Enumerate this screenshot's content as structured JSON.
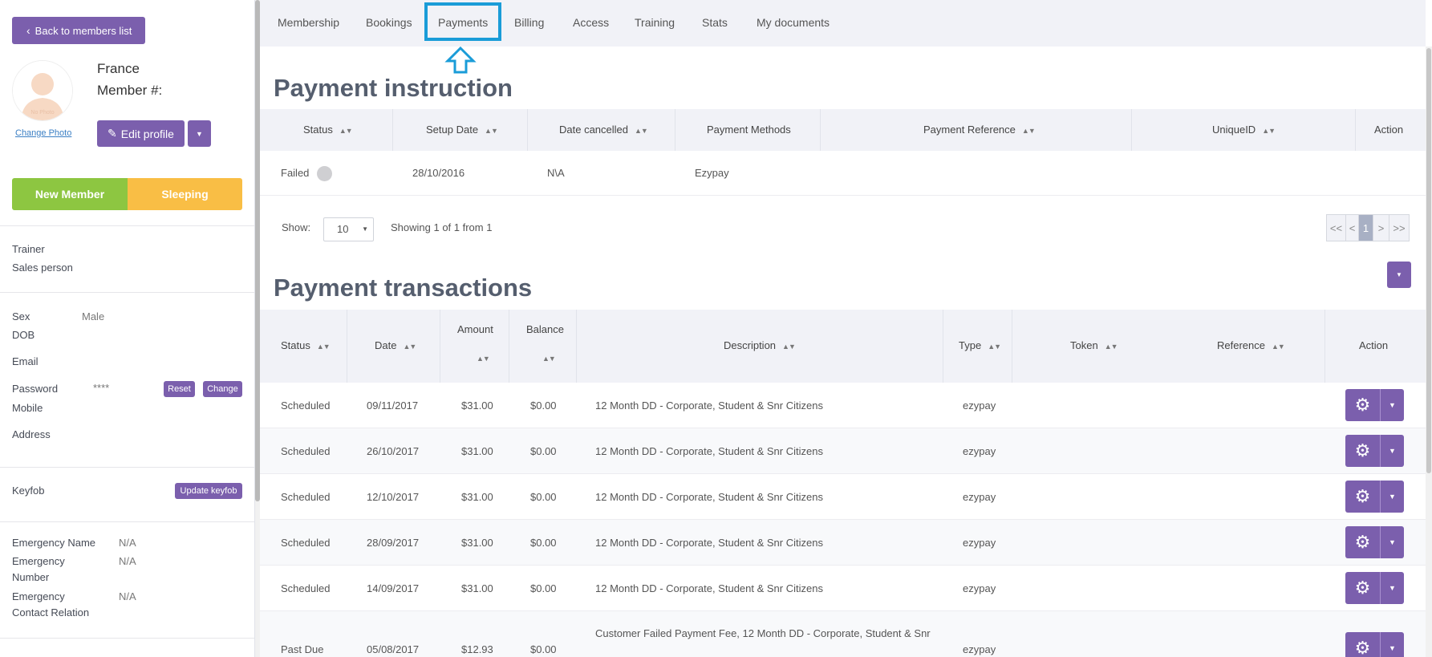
{
  "sidebar": {
    "back_label": "Back to members list",
    "avatar_text": "No Photo",
    "change_photo": "Change Photo",
    "member_name": "France",
    "member_num_label": "Member #:",
    "edit_profile": "Edit profile",
    "status_new": "New Member",
    "status_sleeping": "Sleeping",
    "trainer_label": "Trainer",
    "sales_label": "Sales person",
    "sex_label": "Sex",
    "sex_value": "Male",
    "dob_label": "DOB",
    "email_label": "Email",
    "password_label": "Password",
    "password_value": "****",
    "reset_label": "Reset",
    "change_label": "Change",
    "mobile_label": "Mobile",
    "address_label": "Address",
    "keyfob_label": "Keyfob",
    "update_keyfob": "Update keyfob",
    "emergency_name_label": "Emergency Name",
    "emergency_name_value": "N/A",
    "emergency_number_label1": "Emergency",
    "emergency_number_label2": "Number",
    "emergency_number_value": "N/A",
    "emergency_relation_label1": "Emergency",
    "emergency_relation_label2": "Contact Relation",
    "emergency_relation_value": "N/A"
  },
  "tabs": [
    "Membership",
    "Bookings",
    "Payments",
    "Billing",
    "Access",
    "Training",
    "Stats",
    "My documents"
  ],
  "active_tab": "Payments",
  "instruction": {
    "title": "Payment instruction",
    "headers": [
      "Status",
      "Setup Date",
      "Date cancelled",
      "Payment Methods",
      "Payment Reference",
      "UniqueID",
      "Action"
    ],
    "row": {
      "status": "Failed",
      "setup_date": "28/10/2016",
      "date_cancelled": "N\\A",
      "method": "Ezypay"
    },
    "show_label": "Show:",
    "page_size": "10",
    "showing": "Showing 1 of 1 from 1",
    "pager": [
      "<<",
      "<",
      "1",
      ">",
      ">>"
    ]
  },
  "transactions": {
    "title": "Payment transactions",
    "headers": {
      "status": "Status",
      "date": "Date",
      "amount": "Amount",
      "balance": "Balance",
      "description": "Description",
      "type": "Type",
      "token": "Token",
      "reference": "Reference",
      "action": "Action"
    },
    "rows": [
      {
        "status": "Scheduled",
        "date": "09/11/2017",
        "amount": "$31.00",
        "balance": "$0.00",
        "description": "12 Month DD - Corporate, Student & Snr Citizens",
        "type": "ezypay"
      },
      {
        "status": "Scheduled",
        "date": "26/10/2017",
        "amount": "$31.00",
        "balance": "$0.00",
        "description": "12 Month DD - Corporate, Student & Snr Citizens",
        "type": "ezypay"
      },
      {
        "status": "Scheduled",
        "date": "12/10/2017",
        "amount": "$31.00",
        "balance": "$0.00",
        "description": "12 Month DD - Corporate, Student & Snr Citizens",
        "type": "ezypay"
      },
      {
        "status": "Scheduled",
        "date": "28/09/2017",
        "amount": "$31.00",
        "balance": "$0.00",
        "description": "12 Month DD - Corporate, Student & Snr Citizens",
        "type": "ezypay"
      },
      {
        "status": "Scheduled",
        "date": "14/09/2017",
        "amount": "$31.00",
        "balance": "$0.00",
        "description": "12 Month DD - Corporate, Student & Snr Citizens",
        "type": "ezypay"
      },
      {
        "status": "Past Due",
        "date": "05/08/2017",
        "amount": "$12.93",
        "balance": "$0.00",
        "description": "Customer Failed Payment Fee, 12 Month DD - Corporate, Student & Snr",
        "type": "ezypay"
      }
    ]
  }
}
